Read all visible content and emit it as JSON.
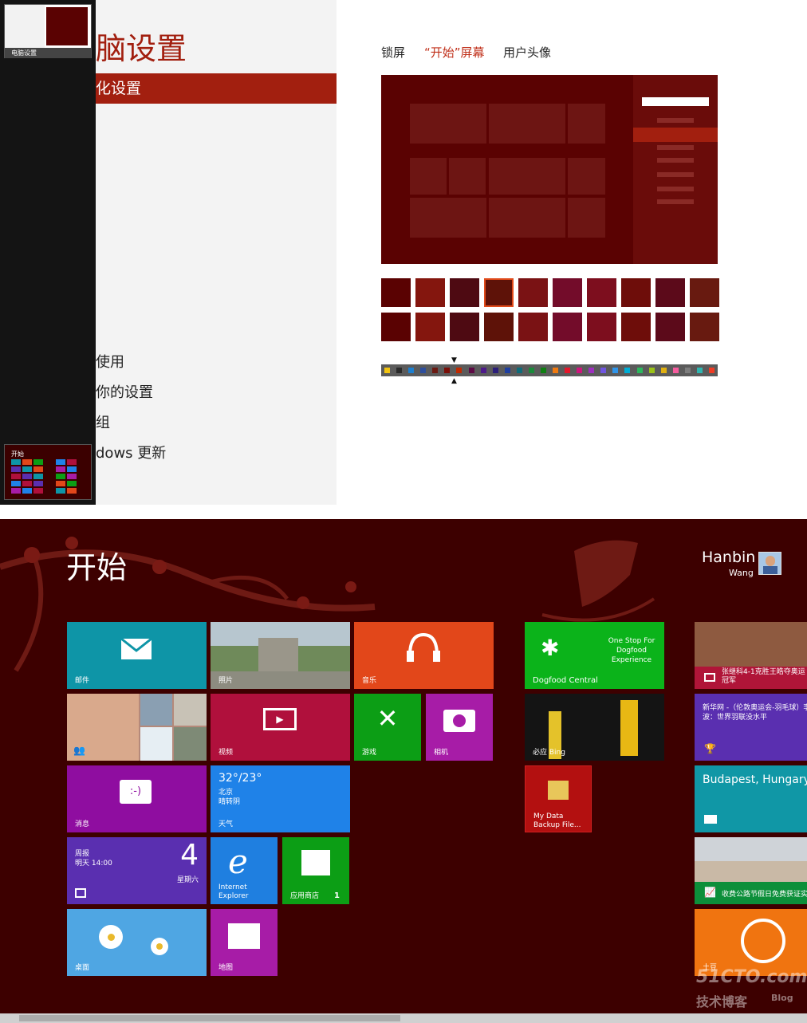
{
  "switcher": {
    "top_app_label": "电脑设置",
    "bottom_app_label": "开始"
  },
  "settings": {
    "title": "电脑设置",
    "selected_item": "个性化设置",
    "items": [
      "使用",
      "你的设置",
      "组",
      "dows 更新"
    ],
    "tabs": [
      "锁屏",
      "“开始”屏幕",
      "用户头像"
    ],
    "active_tab_index": 1,
    "accent_color": "#a21f0f"
  },
  "backgrounds": {
    "rows": 2,
    "columns": 10,
    "selected_index": 3
  },
  "colors": {
    "swatches": [
      "#f3c40f",
      "#2a2a2a",
      "#1d7fcf",
      "#2d4e9c",
      "#6b1a12",
      "#7a0f08",
      "#c02a00",
      "#5d0a45",
      "#4d1a8a",
      "#2b1e7a",
      "#1f3fa0",
      "#0f6c7a",
      "#1a8a3a",
      "#0e7f12",
      "#f07a10",
      "#e5172b",
      "#d0157d",
      "#9d2fbf",
      "#6f55e0",
      "#2f95ea",
      "#00aed6",
      "#2bb85e",
      "#9ac217",
      "#e0b010",
      "#f65c9e",
      "#7d7d7d",
      "#2fb6b0",
      "#f03c24"
    ],
    "selected_index": 6
  },
  "start": {
    "title": "开始",
    "user_first": "Hanbin",
    "user_last": "Wang",
    "background": "#3d0000",
    "tiles": {
      "mail": "邮件",
      "photos": "照片",
      "music": "音乐",
      "dogfood": "Dogfood Central",
      "dogfood_text": "One Stop For Dogfood Experience",
      "sports_news": "张继科4-1克胜王皓夺奥运冠军",
      "video": "视频",
      "games": "游戏",
      "camera": "相机",
      "bing": "必应 Bing",
      "sports_text": "新华网 -（伦敦奥运会-羽毛球）李波：世界羽联没水平",
      "messaging": "消息",
      "weather_temp": "32°/23°",
      "weather_city": "北京",
      "weather_cond": "晴转阴",
      "weather_label": "天气",
      "backup": "My Data Backup File...",
      "travel": "Budapest, Hungary",
      "calendar_top": "周报",
      "calendar_time": "明天 14:00",
      "calendar_day": "4",
      "calendar_weekday": "星期六",
      "ie": "Internet Explorer",
      "store": "应用商店",
      "store_badge": "1",
      "finance": "收费公路节假日免费获证实",
      "desktop": "桌面",
      "maps": "地图",
      "tudou": "土豆"
    }
  },
  "watermark": {
    "line1": "51CTO.com",
    "line2": "技术博客",
    "line3": "Blog"
  }
}
